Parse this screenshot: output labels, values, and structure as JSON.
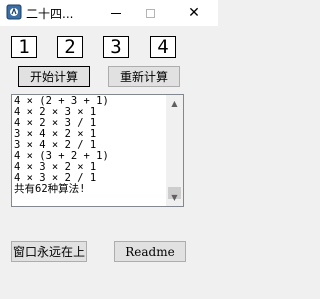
{
  "window": {
    "title": "二十四..."
  },
  "numbers": [
    "1",
    "2",
    "3",
    "4"
  ],
  "buttons": {
    "start": "开始计算",
    "recalc": "重新计算",
    "on_top": "窗口永远在上",
    "readme": "Readme"
  },
  "results": {
    "lines": [
      "4 × (2 + 3 + 1)",
      "4 × 2 × 3 × 1",
      "4 × 2 × 3 / 1",
      "3 × 4 × 2 × 1",
      "3 × 4 × 2 / 1",
      "4 × (3 + 2 + 1)",
      "4 × 3 × 2 × 1",
      "4 × 3 × 2 / 1",
      "共有62种算法!"
    ]
  },
  "icons": {
    "app": "app-icon",
    "minimize": "minimize-icon",
    "maximize": "maximize-icon",
    "close": "close-icon",
    "scroll_up": "chevron-up-icon",
    "scroll_down": "chevron-down-icon"
  }
}
